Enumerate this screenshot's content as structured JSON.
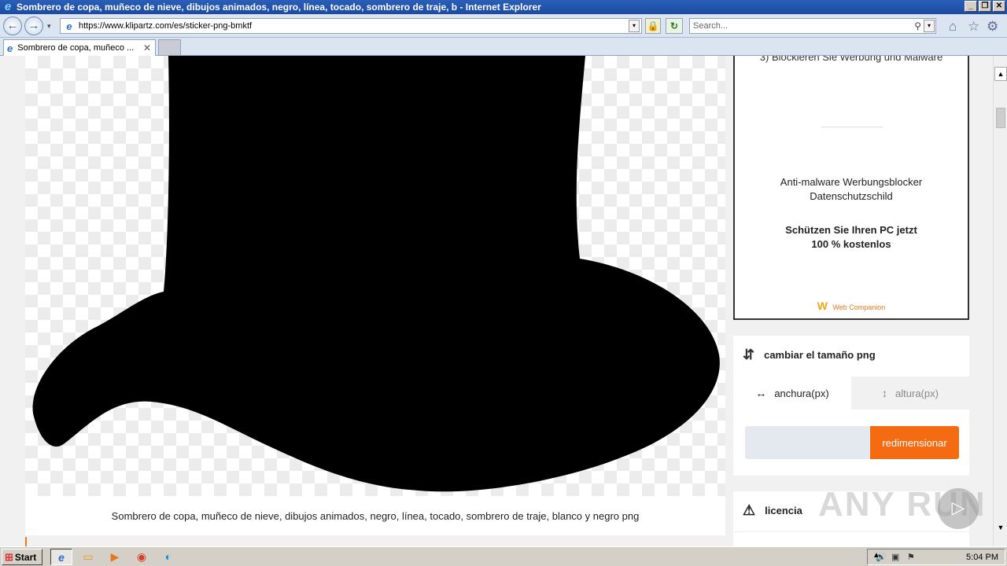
{
  "window": {
    "title": "Sombrero de copa, muñeco de nieve, dibujos animados, negro, línea, tocado, sombrero de traje, b - Internet Explorer",
    "minimize": "_",
    "restore": "❐",
    "close": "✕"
  },
  "navbar": {
    "back_glyph": "←",
    "forward_glyph": "→",
    "dropdown_glyph": "▾",
    "address_url": "https://www.klipartz.com/es/sticker-png-bmktf",
    "address_icon": "e",
    "lock_glyph": "🔒",
    "refresh_glyph": "↻",
    "search_placeholder": "Search...",
    "search_icon_glyph": "⚲",
    "home_glyph": "⌂",
    "favorites_glyph": "☆",
    "settings_glyph": "⚙"
  },
  "tabs": [
    {
      "label": "Sombrero de copa, muñeco ...",
      "close": "✕",
      "icon": "e"
    }
  ],
  "page": {
    "caption": "Sombrero de copa, muñeco de nieve, dibujos animados, negro, línea, tocado, sombrero de traje, blanco y negro png",
    "ad": {
      "top_text": "3) Blockieren Sie Werbung und Malware",
      "line1": "Anti-malware Werbungsblocker",
      "line2": "Datenschutzschild",
      "line3": "Schützen Sie Ihren PC jetzt",
      "line4": "100 % kostenlos",
      "brand": "Web Companion",
      "brand_logo": "W"
    },
    "resize": {
      "title": "cambiar el tamaño png",
      "icon": "⇵",
      "width_tab": "anchura(px)",
      "width_icon": "↔",
      "height_tab": "altura(px)",
      "height_icon": "↕",
      "input_value": "",
      "button": "redimensionar"
    },
    "license": {
      "title": "licencia",
      "icon": "⚠"
    },
    "watermark": "ANY RUN",
    "watermark_icon": "▷"
  },
  "scrollbar": {
    "up": "▲",
    "down": "▼"
  },
  "taskbar": {
    "start": "Start",
    "start_logo": "⊞",
    "apps": [
      {
        "name": "internet-explorer",
        "glyph": "e"
      },
      {
        "name": "file-explorer",
        "glyph": "▭"
      },
      {
        "name": "media-player",
        "glyph": "▶"
      },
      {
        "name": "chrome",
        "glyph": "◉"
      },
      {
        "name": "edge",
        "glyph": "◐"
      }
    ],
    "tray_arrow": "▲",
    "tray_icons": [
      "🔊",
      "▣",
      "⚑"
    ],
    "clock": "5:04 PM"
  },
  "colors": {
    "accent_orange": "#f56b12",
    "titlebar_blue": "#1c4aa0"
  }
}
